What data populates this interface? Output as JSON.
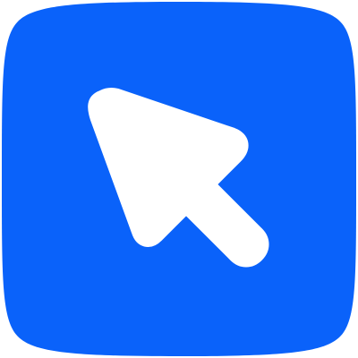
{
  "icon": {
    "name": "cursor-arrow-icon",
    "background_color": "#0A62FA",
    "glyph_color": "#FFFFFF",
    "background_shape": "rounded-square",
    "glyph": "mouse-pointer-arrow"
  }
}
